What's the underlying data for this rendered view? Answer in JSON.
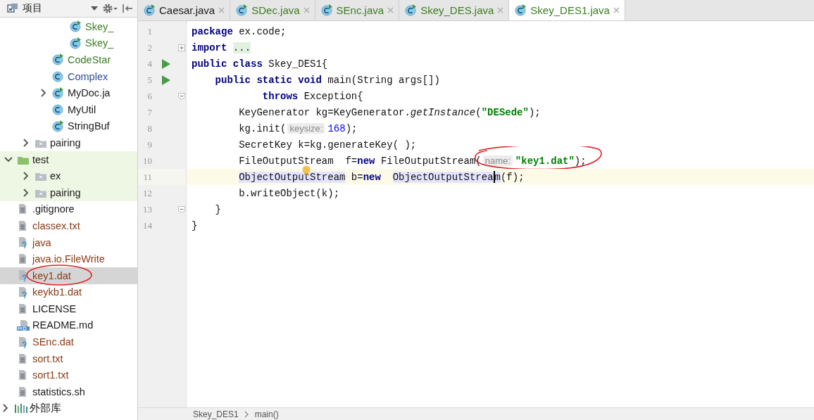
{
  "sidebar": {
    "title": "项目",
    "tree": [
      {
        "children": [
          {
            "children": [
              {
                "children": [
                  {
                    "children": [
                      {
                        "label": "Skey_",
                        "kind": "class",
                        "runnable": true,
                        "color": "#3b7d22",
                        "selected": false
                      },
                      {
                        "label": "Skey_",
                        "kind": "class",
                        "runnable": true,
                        "color": "#3b7d22",
                        "selected": false
                      }
                    ]
                  },
                  {
                    "label": "CodeStar",
                    "kind": "class",
                    "runnable": true,
                    "color": "#3b7d22",
                    "selected": false
                  },
                  {
                    "label": "Complex",
                    "kind": "class",
                    "runnable": false,
                    "color": "#2a4a9c",
                    "selected": false
                  },
                  {
                    "label": "MyDoc.ja",
                    "kind": "class",
                    "runnable": true,
                    "color": "#1a1a1a",
                    "selected": false,
                    "expanded": false
                  },
                  {
                    "label": "MyUtil",
                    "kind": "class",
                    "runnable": false,
                    "color": "#1a1a1a",
                    "selected": false
                  },
                  {
                    "label": "StringBuf",
                    "kind": "class",
                    "runnable": true,
                    "color": "#1a1a1a",
                    "selected": false
                  }
                ]
              },
              {
                "label": "pairing",
                "kind": "folder",
                "color": "#1a1a1a",
                "selected": false,
                "expanded": false
              }
            ]
          },
          {
            "label": "test",
            "kind": "test-folder",
            "color": "#1a1a1a",
            "selected": false,
            "expanded": true,
            "tinted": true,
            "children": [
              {
                "label": "ex",
                "kind": "folder",
                "color": "#1a1a1a",
                "selected": false,
                "expanded": false,
                "tinted": true
              },
              {
                "label": "pairing",
                "kind": "folder",
                "color": "#1a1a1a",
                "selected": false,
                "expanded": false,
                "tinted": true
              }
            ]
          },
          {
            "label": ".gitignore",
            "kind": "file",
            "color": "#1a1a1a",
            "selected": false
          },
          {
            "label": "classex.txt",
            "kind": "file",
            "color": "#8a3a16",
            "selected": false
          },
          {
            "label": "java",
            "kind": "unknown",
            "color": "#8a3a16",
            "selected": false
          },
          {
            "label": "java.io.FileWrite",
            "kind": "file",
            "color": "#8a3a16",
            "selected": false
          },
          {
            "label": "key1.dat",
            "kind": "unknown",
            "color": "#8a3a16",
            "selected": true,
            "circled": true
          },
          {
            "label": "keykb1.dat",
            "kind": "unknown",
            "color": "#8a3a16",
            "selected": false
          },
          {
            "label": "LICENSE",
            "kind": "file",
            "color": "#1a1a1a",
            "selected": false
          },
          {
            "label": "README.md",
            "kind": "markdown",
            "color": "#1a1a1a",
            "selected": false
          },
          {
            "label": "SEnc.dat",
            "kind": "unknown",
            "color": "#8a3a16",
            "selected": false
          },
          {
            "label": "sort.txt",
            "kind": "file",
            "color": "#8a3a16",
            "selected": false
          },
          {
            "label": "sort1.txt",
            "kind": "file",
            "color": "#8a3a16",
            "selected": false
          },
          {
            "label": "statistics.sh",
            "kind": "file",
            "color": "#1a1a1a",
            "selected": false
          }
        ]
      },
      {
        "label": "外部库",
        "kind": "library",
        "color": "#1a1a1a",
        "selected": false,
        "expanded": false
      }
    ]
  },
  "tabs": [
    {
      "label": "Caesar.java",
      "color": "#1a1a1a",
      "selected": false
    },
    {
      "label": "SDec.java",
      "color": "#3b7d22",
      "selected": false
    },
    {
      "label": "SEnc.java",
      "color": "#3b7d22",
      "selected": false
    },
    {
      "label": "Skey_DES.java",
      "color": "#3b7d22",
      "selected": false
    },
    {
      "label": "Skey_DES1.java",
      "color": "#3b7d22",
      "selected": true
    }
  ],
  "editor": {
    "lines": [
      {
        "number": "1",
        "current": false,
        "tokens": [
          {
            "text": "package",
            "kind": "keyword"
          },
          {
            "text": " ex.code;",
            "kind": "plain"
          }
        ]
      },
      {
        "number": "2",
        "current": false,
        "markers": [
          {
            "kind": "fold-expand"
          }
        ],
        "tokens": [
          {
            "text": "import",
            "kind": "keyword"
          },
          {
            "text": " ...",
            "kind": "folded"
          }
        ]
      },
      {
        "number": "4",
        "current": false,
        "markers": [
          {
            "kind": "run"
          }
        ],
        "tokens": [
          {
            "text": "public class",
            "kind": "keyword"
          },
          {
            "text": " Skey_DES1{",
            "kind": "plain"
          }
        ]
      },
      {
        "number": "5",
        "current": false,
        "markers": [
          {
            "kind": "run"
          }
        ],
        "tokens": [
          {
            "text": "    public static void",
            "kind": "keyword"
          },
          {
            "text": " main(String args[])",
            "kind": "plain"
          }
        ]
      },
      {
        "number": "6",
        "current": false,
        "markers": [
          {
            "kind": "fold-collapse"
          }
        ],
        "tokens": [
          {
            "text": "            throws",
            "kind": "keyword"
          },
          {
            "text": " Exception{",
            "kind": "plain"
          }
        ]
      },
      {
        "number": "7",
        "current": false,
        "tokens": [
          {
            "text": "        KeyGenerator kg=KeyGenerator.",
            "kind": "plain"
          },
          {
            "text": "getInstance",
            "kind": "italic"
          },
          {
            "text": "(",
            "kind": "plain"
          },
          {
            "text": "\"DESede\"",
            "kind": "string"
          },
          {
            "text": ");",
            "kind": "plain"
          }
        ]
      },
      {
        "number": "8",
        "current": false,
        "tokens": [
          {
            "text": "        kg.init(",
            "kind": "plain"
          },
          {
            "text": "keysize:",
            "kind": "hint"
          },
          {
            "text": "168",
            "kind": "number"
          },
          {
            "text": ");",
            "kind": "plain"
          }
        ]
      },
      {
        "number": "9",
        "current": false,
        "tokens": [
          {
            "text": "        SecretKey k=kg.generateKey( );",
            "kind": "plain"
          }
        ]
      },
      {
        "number": "10",
        "current": false,
        "tokens": [
          {
            "text": "        FileOutputStream  f=",
            "kind": "plain"
          },
          {
            "text": "new",
            "kind": "keyword"
          },
          {
            "text": " FileOutputStream(",
            "kind": "plain"
          },
          {
            "text": "name:",
            "kind": "hint",
            "circled": true
          },
          {
            "text": "\"key1.dat\"",
            "kind": "string",
            "circled": true
          },
          {
            "text": ");",
            "kind": "plain",
            "circled": true
          }
        ]
      },
      {
        "number": "11",
        "current": true,
        "tokens": [
          {
            "text": "        ObjectOutpu",
            "kind": "match"
          },
          {
            "kind": "bulb"
          },
          {
            "text": "tStream",
            "kind": "match"
          },
          {
            "text": " b=",
            "kind": "plain"
          },
          {
            "text": "new",
            "kind": "keyword"
          },
          {
            "text": "  ObjectOutputStrea",
            "kind": "match"
          },
          {
            "kind": "caret"
          },
          {
            "text": "m",
            "kind": "match"
          },
          {
            "text": "(f);",
            "kind": "plain"
          }
        ]
      },
      {
        "number": "12",
        "current": false,
        "tokens": [
          {
            "text": "        b.writeObject(k);",
            "kind": "plain"
          }
        ]
      },
      {
        "number": "13",
        "current": false,
        "markers": [
          {
            "kind": "fold-collapse"
          }
        ],
        "tokens": [
          {
            "text": "    }",
            "kind": "plain"
          }
        ]
      },
      {
        "number": "14",
        "current": false,
        "tokens": [
          {
            "text": "}",
            "kind": "plain"
          }
        ]
      }
    ]
  },
  "breadcrumb": [
    "Skey_DES1",
    "main()"
  ]
}
